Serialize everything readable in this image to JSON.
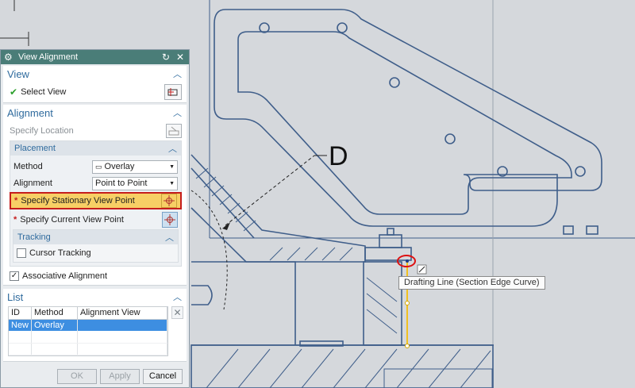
{
  "canvas": {
    "section_label": "D",
    "tooltip": "Drafting Line (Section Edge Curve)"
  },
  "dialog": {
    "title": "View Alignment",
    "view_group": {
      "title": "View",
      "select_view_label": "Select View"
    },
    "alignment_group": {
      "title": "Alignment",
      "specify_location_label": "Specify Location",
      "placement": {
        "title": "Placement",
        "method_label": "Method",
        "method_value": "Overlay",
        "alignment_label": "Alignment",
        "alignment_value": "Point to Point",
        "stationary_point_label": "Specify Stationary View Point",
        "current_point_label": "Specify Current View Point",
        "tracking": {
          "title": "Tracking",
          "cursor_tracking_label": "Cursor Tracking",
          "cursor_tracking_checked": false
        }
      },
      "associative_alignment_label": "Associative Alignment",
      "associative_alignment_checked": true
    },
    "list_group": {
      "title": "List",
      "columns": [
        "ID",
        "Method",
        "Alignment View"
      ],
      "rows": [
        {
          "id": "New",
          "method": "Overlay",
          "view": ""
        }
      ]
    },
    "footer": {
      "ok_label": "OK",
      "apply_label": "Apply",
      "cancel_label": "Cancel"
    }
  },
  "colors": {
    "titlebar": "#4a7d78",
    "heading": "#2f6b9e",
    "highlight_fill": "#f7cf65",
    "highlight_border": "#c51d1d",
    "cad_line": "#3f5e8a",
    "selected_row": "#3d8ee1"
  }
}
